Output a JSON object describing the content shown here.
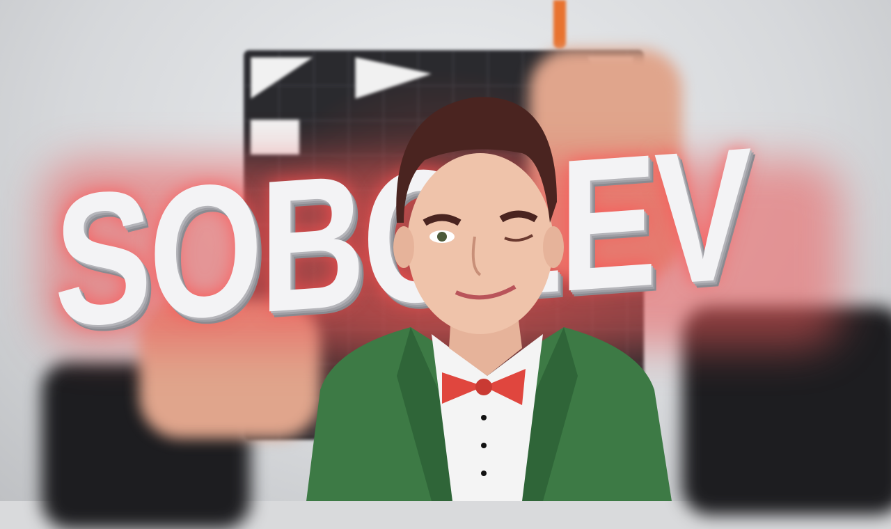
{
  "title_text": "SOBOLEV",
  "colors": {
    "glow": "#e85a5a",
    "jacket": "#3d7a45",
    "bowtie": "#e0463e",
    "pen": "#e8732f"
  },
  "subject": {
    "icon": "caricature-man-icon"
  }
}
